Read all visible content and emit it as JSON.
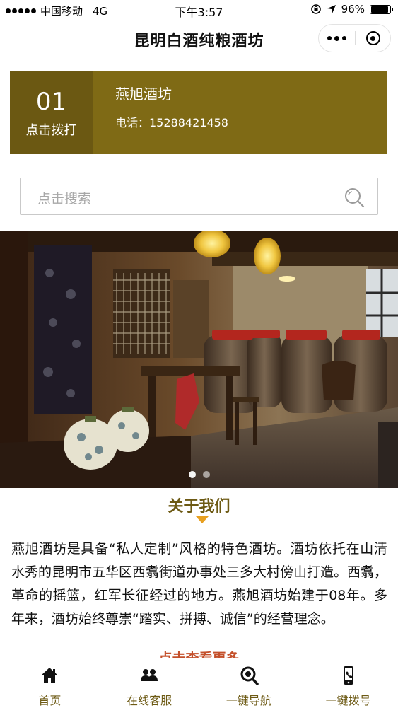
{
  "status": {
    "carrier": "中国移动",
    "network": "4G",
    "time": "下午3:57",
    "battery": "96%"
  },
  "navbar": {
    "title": "昆明白酒纯粮酒坊"
  },
  "contact": {
    "number": "01",
    "call_label": "点击拨打",
    "name": "燕旭酒坊",
    "phone": "电话：15288421458"
  },
  "search": {
    "placeholder": "点击搜索"
  },
  "carousel": {
    "total": 2,
    "active_index": 0
  },
  "about": {
    "title": "关于我们",
    "text": "燕旭酒坊是具备“私人定制”风格的特色酒坊。酒坊依托在山清水秀的昆明市五华区西翥街道办事处三多大村傍山打造。西翥，革命的摇篮，红军长征经过的地方。燕旭酒坊始建于08年。多年来，酒坊始终尊崇“踏实、拼搏、诚信”的经营理念。",
    "more_label": "点击查看更多"
  },
  "tabs": [
    {
      "label": "首页",
      "icon": "home-icon"
    },
    {
      "label": "在线客服",
      "icon": "people-icon"
    },
    {
      "label": "一键导航",
      "icon": "navigation-icon"
    },
    {
      "label": "一键拨号",
      "icon": "phone-icon"
    }
  ],
  "colors": {
    "brand": "#7f6a15",
    "brand_dark": "#6b5812",
    "accent": "#e8a020",
    "link": "#c4502b"
  }
}
